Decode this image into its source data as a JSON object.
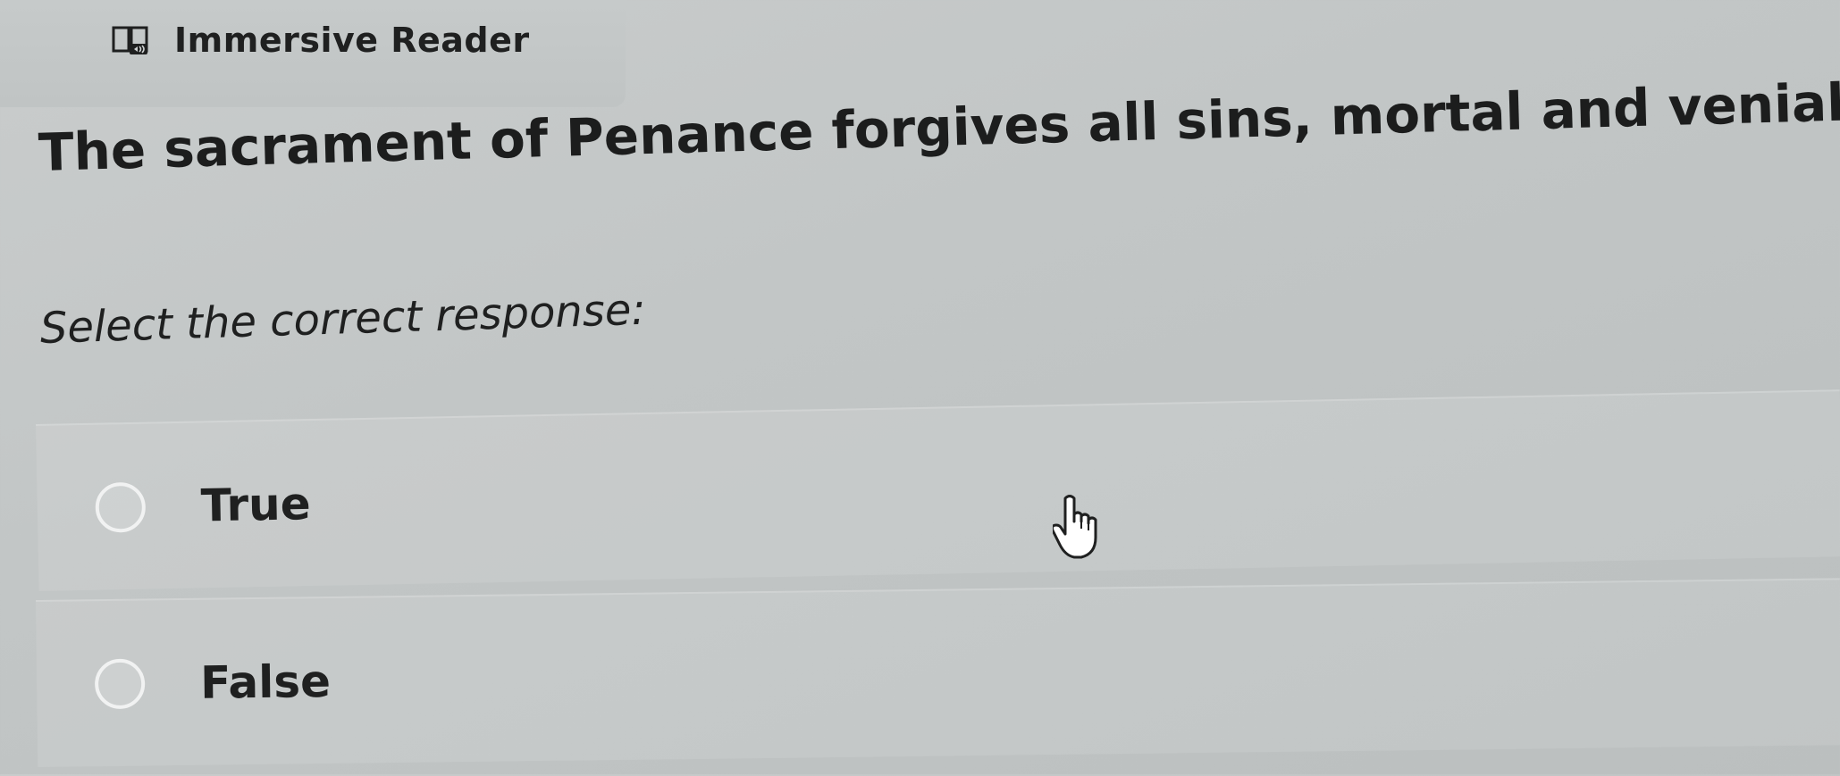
{
  "toolbar": {
    "immersive_reader_label": "Immersive Reader",
    "immersive_reader_icon": "immersive-reader-icon"
  },
  "question": {
    "text": "The sacrament of Penance forgives all sins, mortal and venial.",
    "instruction": "Select the correct response:"
  },
  "answers": [
    {
      "label": "True",
      "selected": false
    },
    {
      "label": "False",
      "selected": false
    }
  ],
  "cursor": {
    "icon": "hand-pointer-icon"
  },
  "colors": {
    "background": "#c4c8c8",
    "text": "#1f2020",
    "radio_border": "#f1f2f2"
  }
}
